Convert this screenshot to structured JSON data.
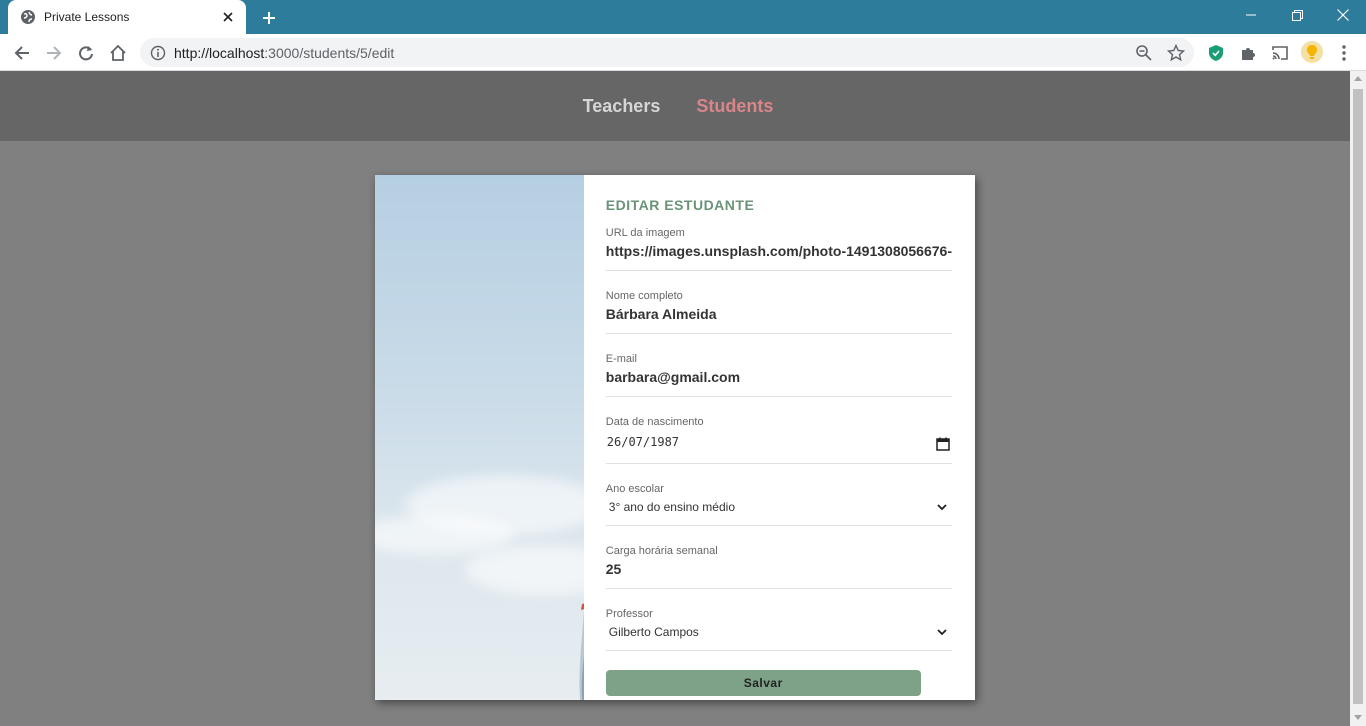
{
  "browser": {
    "tab_title": "Private Lessons",
    "url_host": "http://localhost",
    "url_path": ":3000/students/5/edit",
    "theme_color": "#2e7c9b",
    "icons": [
      "globe-icon",
      "close-icon",
      "plus-icon",
      "minimize-icon",
      "restore-icon",
      "back-icon",
      "forward-icon",
      "reload-icon",
      "home-icon",
      "info-icon",
      "zoom-icon",
      "star-icon",
      "shield-icon",
      "puzzle-icon",
      "cast-icon",
      "menu-icon"
    ]
  },
  "nav": {
    "teachers": "Teachers",
    "students": "Students",
    "active_color": "#d8868a"
  },
  "form": {
    "title": "EDITAR ESTUDANTE",
    "avatar_url": {
      "label": "URL da imagem",
      "value": "https://images.unsplash.com/photo-1491308056676-"
    },
    "name": {
      "label": "Nome completo",
      "value": "Bárbara Almeida"
    },
    "email": {
      "label": "E-mail",
      "value": "barbara@gmail.com"
    },
    "birth": {
      "label": "Data de nascimento",
      "value": "26/07/1987"
    },
    "grade": {
      "label": "Ano escolar",
      "value": "3° ano do ensino médio"
    },
    "hours": {
      "label": "Carga horária semanal",
      "value": "25"
    },
    "teacher": {
      "label": "Professor",
      "value": "Gilberto Campos"
    },
    "submit": "Salvar",
    "accent_color": "#6a9378",
    "button_color": "#7ea287"
  }
}
